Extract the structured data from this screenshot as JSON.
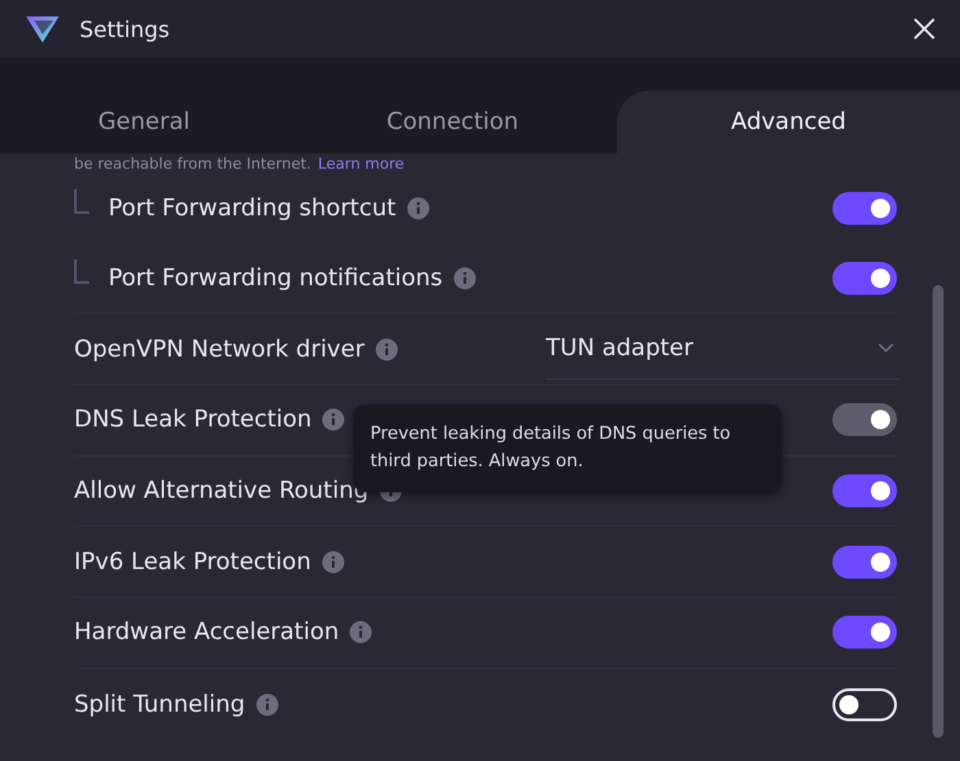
{
  "window": {
    "title": "Settings"
  },
  "tabs": [
    {
      "label": "General",
      "selected": false
    },
    {
      "label": "Connection",
      "selected": false
    },
    {
      "label": "Advanced",
      "selected": true
    }
  ],
  "intro": {
    "text": "be reachable from the Internet.",
    "link": "Learn more"
  },
  "settings": [
    {
      "kind": "toggle",
      "label": "Port Forwarding shortcut",
      "sub": true,
      "on": true,
      "disabled": false
    },
    {
      "kind": "toggle",
      "label": "Port Forwarding notifications",
      "sub": true,
      "on": true,
      "disabled": false
    },
    {
      "kind": "select",
      "label": "OpenVPN Network driver",
      "value": "TUN adapter"
    },
    {
      "kind": "toggle",
      "label": "DNS Leak Protection",
      "sub": false,
      "on": true,
      "disabled": true
    },
    {
      "kind": "toggle",
      "label": "Allow Alternative Routing",
      "sub": false,
      "on": true,
      "disabled": false
    },
    {
      "kind": "toggle",
      "label": "IPv6 Leak Protection",
      "sub": false,
      "on": true,
      "disabled": false
    },
    {
      "kind": "toggle",
      "label": "Hardware Acceleration",
      "sub": false,
      "on": true,
      "disabled": false
    },
    {
      "kind": "toggle",
      "label": "Split Tunneling",
      "sub": false,
      "on": false,
      "disabled": false
    }
  ],
  "tooltip": {
    "text": "Prevent leaking details of DNS queries to third parties. Always on."
  }
}
